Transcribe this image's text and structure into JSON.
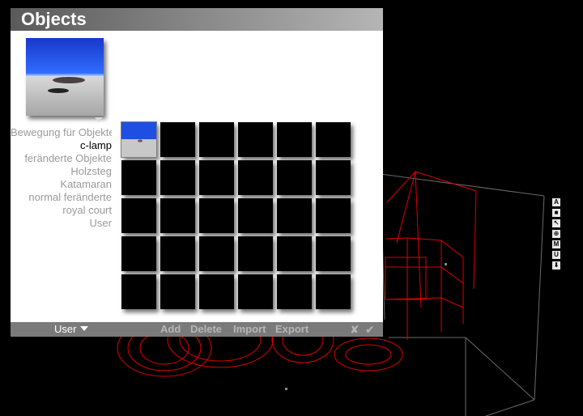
{
  "panel": {
    "title": "Objects",
    "categories": [
      {
        "label": "Bewegung für Objekte",
        "selected": false
      },
      {
        "label": "c-lamp",
        "selected": true
      },
      {
        "label": "feränderte Objekte",
        "selected": false
      },
      {
        "label": "Holzsteg",
        "selected": false
      },
      {
        "label": "Katamaran",
        "selected": false
      },
      {
        "label": "normal feränderte",
        "selected": false
      },
      {
        "label": "royal court",
        "selected": false
      },
      {
        "label": "User",
        "selected": false
      }
    ],
    "thumbnails": {
      "rows": 5,
      "cols": 6,
      "selected_index": 0
    }
  },
  "bottom_bar": {
    "user_dropdown": "User",
    "add": "Add",
    "delete": "Delete",
    "import": "Import",
    "export": "Export",
    "cancel_glyph": "✘",
    "ok_glyph": "✔"
  },
  "side_toolbar": [
    {
      "name": "a-tool",
      "glyph": "A"
    },
    {
      "name": "square-tool",
      "glyph": "■"
    },
    {
      "name": "cursor-tool",
      "glyph": "↖"
    },
    {
      "name": "target-tool",
      "glyph": "⊕"
    },
    {
      "name": "m-tool",
      "glyph": "M"
    },
    {
      "name": "u-tool",
      "glyph": "U"
    },
    {
      "name": "down-arrow-tool",
      "glyph": "⬇"
    }
  ],
  "colors": {
    "background": "#000000",
    "wireframe": "#ff0000",
    "panel_bg": "#ffffff",
    "header_gradient_start": "#5a5a5a",
    "sky": "#1a3fd0",
    "ground": "#b0b0b0"
  }
}
